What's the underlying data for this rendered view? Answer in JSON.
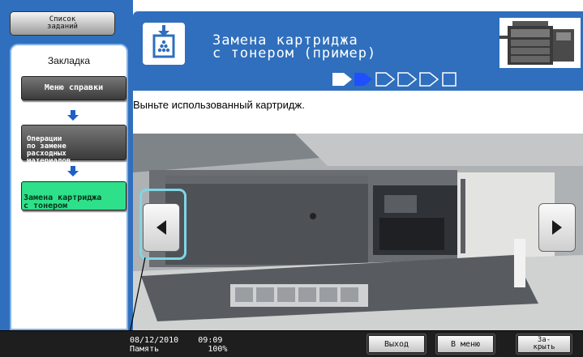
{
  "left_panel": {
    "jobs_tab_label": "Список\nзаданий",
    "bookmark_title": "Закладка",
    "items": [
      {
        "label": "Меню справки"
      },
      {
        "label": "Операции\nпо замене\nрасходных\nматериалов"
      },
      {
        "label": "Замена картриджа\nс тонером"
      }
    ]
  },
  "header": {
    "title": "Замена картриджа\nс тонером (пример)",
    "icon": "toner-icon",
    "progress_steps": 6,
    "progress_current": 2
  },
  "main": {
    "instruction": "Выньте использованный картридж."
  },
  "status_bar": {
    "datetime": "08/12/2010    09:09\nПамять          100%",
    "buttons": {
      "exit": "Выход",
      "menu": "В меню",
      "close": "За-\nкрыть"
    }
  },
  "colors": {
    "panel_blue": "#2f6fbd",
    "active_green": "#2fe08a",
    "highlight_cyan": "#7fd6e6"
  }
}
